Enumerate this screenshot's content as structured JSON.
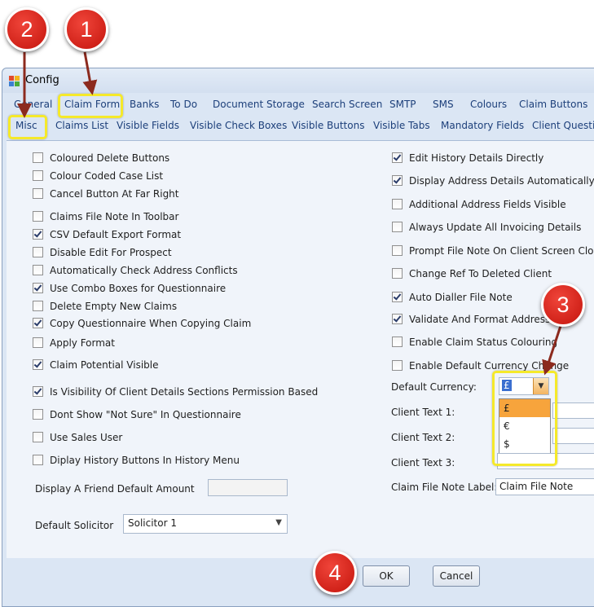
{
  "window": {
    "title": "Config"
  },
  "tabs_row1": [
    "General",
    "Claim Form",
    "Banks",
    "To Do",
    "Document Storage",
    "Search Screen",
    "SMTP",
    "SMS",
    "Colours",
    "Claim Buttons"
  ],
  "tabs_row2": [
    "Misc",
    "Claims List",
    "Visible Fields",
    "Visible Check Boxes",
    "Visible Buttons",
    "Visible Tabs",
    "Mandatory Fields",
    "Client Questio"
  ],
  "left_checks": [
    {
      "label": "Coloured Delete Buttons",
      "checked": false
    },
    {
      "label": "Colour Coded Case List",
      "checked": false
    },
    {
      "label": "Cancel Button At Far Right",
      "checked": false
    },
    {
      "label": "Claims File Note In Toolbar",
      "checked": false
    },
    {
      "label": "CSV Default Export Format",
      "checked": true
    },
    {
      "label": "Disable Edit For Prospect",
      "checked": false
    },
    {
      "label": "Automatically Check Address Conflicts",
      "checked": false
    },
    {
      "label": "Use Combo Boxes for Questionnaire",
      "checked": true
    },
    {
      "label": "Delete Empty New Claims",
      "checked": false
    },
    {
      "label": "Copy Questionnaire When Copying Claim",
      "checked": true
    },
    {
      "label": "Apply Format",
      "checked": false
    },
    {
      "label": "Claim Potential Visible",
      "checked": true
    },
    {
      "label": "Is Visibility Of Client Details Sections Permission Based",
      "checked": true
    },
    {
      "label": "Dont Show \"Not Sure\" In Questionnaire",
      "checked": false
    },
    {
      "label": "Use Sales User",
      "checked": false
    },
    {
      "label": "Diplay History Buttons In History Menu",
      "checked": false
    }
  ],
  "right_checks": [
    {
      "label": "Edit History Details Directly",
      "checked": true
    },
    {
      "label": "Display Address Details Automatically",
      "checked": true
    },
    {
      "label": "Additional Address Fields Visible",
      "checked": false
    },
    {
      "label": "Always Update All Invoicing Details",
      "checked": false
    },
    {
      "label": "Prompt File Note On Client Screen Closure",
      "checked": false
    },
    {
      "label": "Change Ref To Deleted Client",
      "checked": false
    },
    {
      "label": "Auto Dialler File Note",
      "checked": true
    },
    {
      "label": "Validate And Format Address",
      "checked": true
    },
    {
      "label": "Enable Claim Status Colouring",
      "checked": false
    },
    {
      "label": "Enable Default Currency Change",
      "checked": false
    }
  ],
  "fields": {
    "friend_amount_label": "Display A Friend Default Amount",
    "friend_amount_value": "",
    "solicitor_label": "Default Solicitor",
    "solicitor_value": "Solicitor 1",
    "currency_label": "Default Currency:",
    "currency_value": "£",
    "currency_options": [
      "£",
      "€",
      "$"
    ],
    "client_text1_label": "Client Text 1:",
    "client_text2_label": "Client Text 2:",
    "client_text3_label": "Client Text 3:",
    "file_note_label": "Claim File Note Label:",
    "file_note_value": "Claim File Note"
  },
  "buttons": {
    "ok": "OK",
    "cancel": "Cancel"
  },
  "markers": [
    "1",
    "2",
    "3",
    "4"
  ],
  "colors": {
    "marker": "#d8201a",
    "highlight": "#f5e92a",
    "selected_option": "#f7a43c"
  }
}
